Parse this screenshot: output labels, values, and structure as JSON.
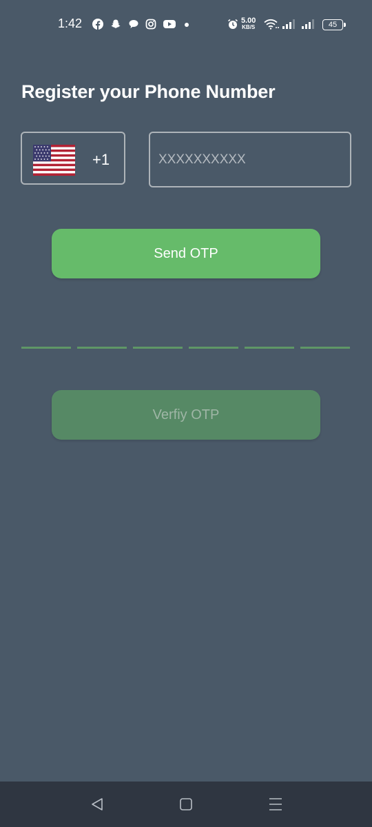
{
  "status_bar": {
    "time": "1:42",
    "net_speed_value": "5.00",
    "net_speed_unit": "KB/S",
    "battery": "45",
    "icons": [
      "facebook-icon",
      "snapchat-icon",
      "chat-icon",
      "instagram-icon",
      "youtube-icon",
      "alarm-icon",
      "wifi-icon",
      "signal-icon",
      "signal-icon-2"
    ]
  },
  "page": {
    "title": "Register your Phone Number"
  },
  "phone": {
    "country_flag": "us-flag-icon",
    "country_code": "+1",
    "placeholder": "XXXXXXXXXX",
    "value": ""
  },
  "buttons": {
    "send_otp": "Send OTP",
    "verify_otp": "Verfiy OTP"
  },
  "otp": {
    "slot_count": 6
  },
  "colors": {
    "background": "#4a5968",
    "send_button": "#66bb6a",
    "verify_button": "#568965",
    "otp_underline": "#5f9766",
    "nav_bar": "#2f3641"
  }
}
